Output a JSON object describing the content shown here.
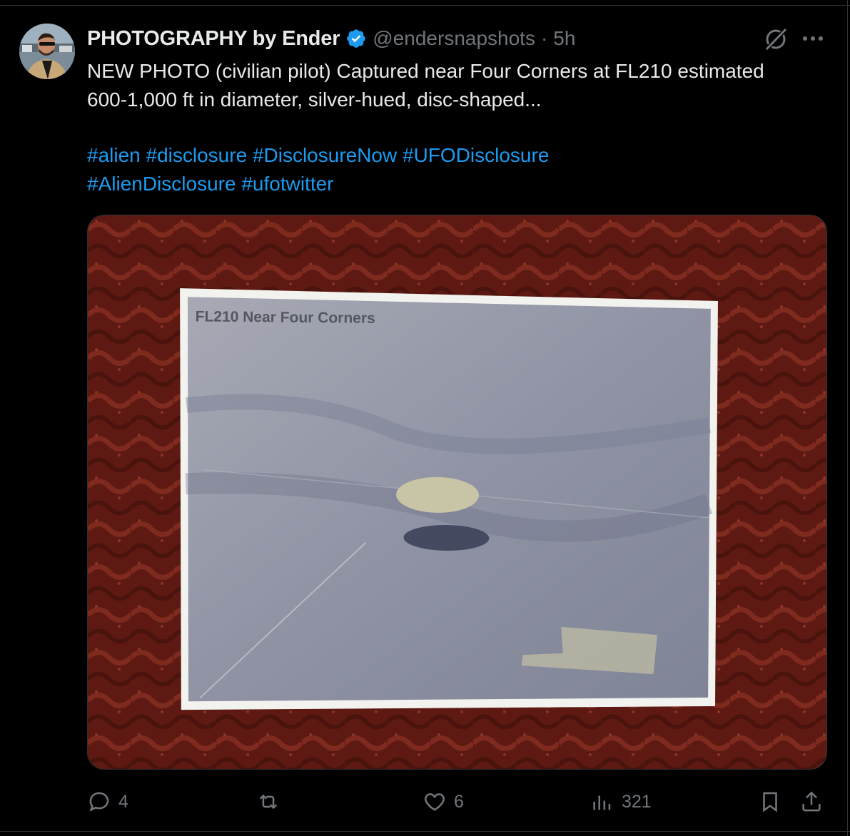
{
  "tweet": {
    "display_name": "PHOTOGRAPHY by Ender",
    "handle": "@endersnapshots",
    "separator": "·",
    "time": "5h",
    "text_line1": "NEW PHOTO (civilian pilot) Captured near Four Corners at FL210 estimated",
    "text_line2": "600-1,000 ft in diameter, silver-hued, disc-shaped...",
    "hashtags_line1": [
      "#alien",
      "#disclosure",
      "#DisclosureNow",
      "#UFODisclosure"
    ],
    "hashtags_line2": [
      "#AlienDisclosure",
      "#ufotwitter"
    ],
    "photo_caption": "FL210 Near Four Corners"
  },
  "actions": {
    "replies": "4",
    "reposts": "",
    "likes": "6",
    "views": "321"
  },
  "colors": {
    "background": "#000000",
    "text": "#e7e9ea",
    "muted": "#71767b",
    "link": "#1d9bf0",
    "verified": "#1d9bf0",
    "carpet": "#6a1c14"
  },
  "icons": [
    "verified-badge-icon",
    "grok-icon",
    "more-icon",
    "reply-icon",
    "repost-icon",
    "like-icon",
    "views-icon",
    "bookmark-icon",
    "share-icon"
  ]
}
